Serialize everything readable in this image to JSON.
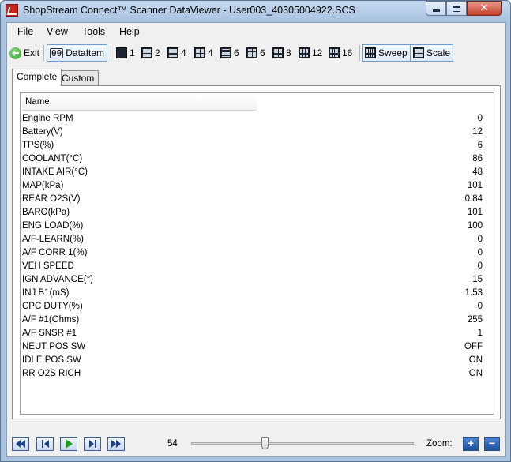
{
  "window": {
    "title": "ShopStream Connect™ Scanner DataViewer - User003_40305004922.SCS",
    "app_icon": "snapon-logo-icon"
  },
  "menu": {
    "items": [
      "File",
      "View",
      "Tools",
      "Help"
    ]
  },
  "toolbar": {
    "exit": "Exit",
    "dataitem": "DataItem",
    "dataitem_icon": "θθ",
    "layouts": [
      "1",
      "2",
      "4",
      "4",
      "6",
      "6",
      "8",
      "12",
      "16"
    ],
    "sweep": "Sweep",
    "scale": "Scale"
  },
  "tabs": [
    "Complete",
    "Custom"
  ],
  "table": {
    "header": "Name",
    "rows": [
      {
        "name": "Engine RPM",
        "value": "0"
      },
      {
        "name": "Battery(V)",
        "value": "12"
      },
      {
        "name": "TPS(%)",
        "value": "6"
      },
      {
        "name": "COOLANT(°C)",
        "value": "86"
      },
      {
        "name": "INTAKE AIR(°C)",
        "value": "48"
      },
      {
        "name": "MAP(kPa)",
        "value": "101"
      },
      {
        "name": "REAR O2S(V)",
        "value": "0.84"
      },
      {
        "name": "BARO(kPa)",
        "value": "101"
      },
      {
        "name": "ENG LOAD(%)",
        "value": "100"
      },
      {
        "name": "A/F-LEARN(%)",
        "value": "0"
      },
      {
        "name": "A/F CORR 1(%)",
        "value": "0"
      },
      {
        "name": "VEH SPEED",
        "value": "0"
      },
      {
        "name": "IGN ADVANCE(°)",
        "value": "15"
      },
      {
        "name": "INJ B1(mS)",
        "value": "1.53"
      },
      {
        "name": "CPC DUTY(%)",
        "value": "0"
      },
      {
        "name": "A/F #1(Ohms)",
        "value": "255"
      },
      {
        "name": "A/F SNSR #1",
        "value": "1"
      },
      {
        "name": "NEUT POS SW",
        "value": "OFF"
      },
      {
        "name": "IDLE POS SW",
        "value": "ON"
      },
      {
        "name": "RR O2S RICH",
        "value": "ON"
      }
    ]
  },
  "playback": {
    "position": "54",
    "slider_fraction": 0.33,
    "zoom_label": "Zoom:",
    "zoom_in": "+",
    "zoom_out": "−"
  }
}
